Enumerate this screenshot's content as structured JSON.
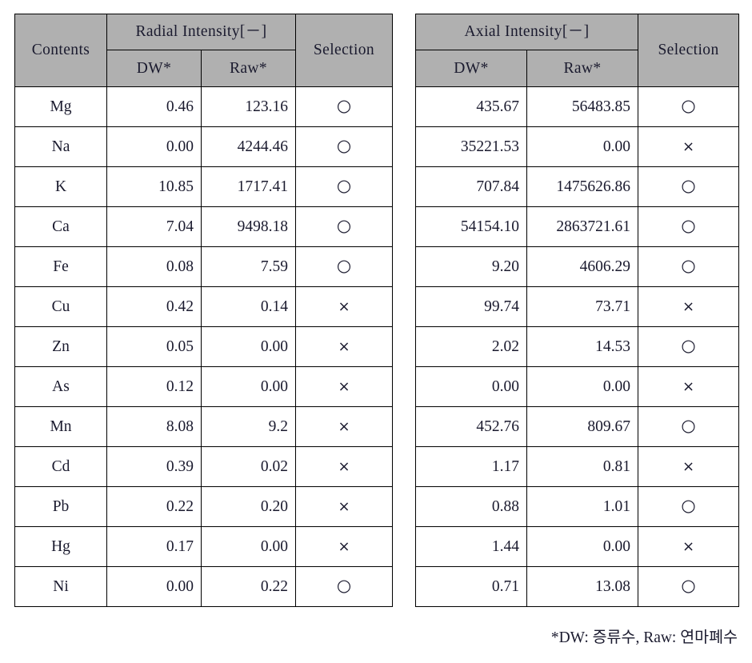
{
  "tables": [
    {
      "id": "radial",
      "first_col_header": "Contents",
      "group_header": "Radial Intensity[－]",
      "sub_headers": [
        "DW*",
        "Raw*"
      ],
      "selection_header": "Selection",
      "rows": [
        {
          "contents": "Mg",
          "dw": "0.46",
          "raw": "123.16",
          "selection": "○"
        },
        {
          "contents": "Na",
          "dw": "0.00",
          "raw": "4244.46",
          "selection": "○"
        },
        {
          "contents": "K",
          "dw": "10.85",
          "raw": "1717.41",
          "selection": "○"
        },
        {
          "contents": "Ca",
          "dw": "7.04",
          "raw": "9498.18",
          "selection": "○"
        },
        {
          "contents": "Fe",
          "dw": "0.08",
          "raw": "7.59",
          "selection": "○"
        },
        {
          "contents": "Cu",
          "dw": "0.42",
          "raw": "0.14",
          "selection": "×"
        },
        {
          "contents": "Zn",
          "dw": "0.05",
          "raw": "0.00",
          "selection": "×"
        },
        {
          "contents": "As",
          "dw": "0.12",
          "raw": "0.00",
          "selection": "×"
        },
        {
          "contents": "Mn",
          "dw": "8.08",
          "raw": "9.2",
          "selection": "×"
        },
        {
          "contents": "Cd",
          "dw": "0.39",
          "raw": "0.02",
          "selection": "×"
        },
        {
          "contents": "Pb",
          "dw": "0.22",
          "raw": "0.20",
          "selection": "×"
        },
        {
          "contents": "Hg",
          "dw": "0.17",
          "raw": "0.00",
          "selection": "×"
        },
        {
          "contents": "Ni",
          "dw": "0.00",
          "raw": "0.22",
          "selection": "○"
        }
      ]
    },
    {
      "id": "axial",
      "group_header": "Axial Intensity[－]",
      "sub_headers": [
        "DW*",
        "Raw*"
      ],
      "selection_header": "Selection",
      "rows": [
        {
          "dw": "435.67",
          "raw": "56483.85",
          "selection": "○"
        },
        {
          "dw": "35221.53",
          "raw": "0.00",
          "selection": "×"
        },
        {
          "dw": "707.84",
          "raw": "1475626.86",
          "selection": "○"
        },
        {
          "dw": "54154.10",
          "raw": "2863721.61",
          "selection": "○"
        },
        {
          "dw": "9.20",
          "raw": "4606.29",
          "selection": "○"
        },
        {
          "dw": "99.74",
          "raw": "73.71",
          "selection": "×"
        },
        {
          "dw": "2.02",
          "raw": "14.53",
          "selection": "○"
        },
        {
          "dw": "0.00",
          "raw": "0.00",
          "selection": "×"
        },
        {
          "dw": "452.76",
          "raw": "809.67",
          "selection": "○"
        },
        {
          "dw": "1.17",
          "raw": "0.81",
          "selection": "×"
        },
        {
          "dw": "0.88",
          "raw": "1.01",
          "selection": "○"
        },
        {
          "dw": "1.44",
          "raw": "0.00",
          "selection": "×"
        },
        {
          "dw": "0.71",
          "raw": "13.08",
          "selection": "○"
        }
      ]
    }
  ],
  "footnote": "*DW: 증류수, Raw: 연마폐수",
  "colors": {
    "header_background": "#b0b0b0",
    "border": "#000000",
    "text": "#1a1a2e",
    "cell_background": "#ffffff"
  }
}
